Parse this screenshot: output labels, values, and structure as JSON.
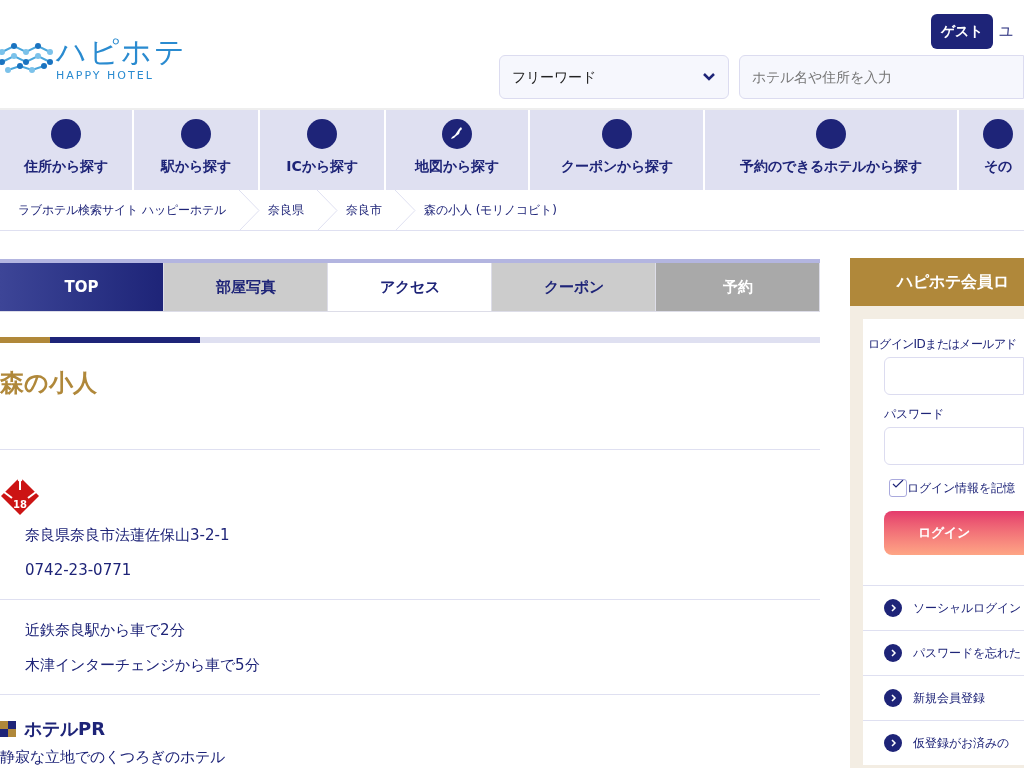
{
  "header": {
    "logo_text": "ハピホテ",
    "logo_sub": "HAPPY HOTEL",
    "guest_badge": "ゲスト",
    "user_link": "ユ",
    "search_select": "フリーワード",
    "search_placeholder": "ホテル名や住所を入力"
  },
  "nav": [
    {
      "label": "住所から探す",
      "kind": "blank"
    },
    {
      "label": "駅から探す",
      "kind": "blank"
    },
    {
      "label": "ICから探す",
      "kind": "blank"
    },
    {
      "label": "地図から探す",
      "kind": "map"
    },
    {
      "label": "クーポンから探す",
      "kind": "blank"
    },
    {
      "label": "予約のできるホテルから探す",
      "kind": "blank"
    },
    {
      "label": "その",
      "kind": "blank"
    }
  ],
  "breadcrumb": [
    "ラブホテル検索サイト ハッピーホテル",
    "奈良県",
    "奈良市",
    "森の小人 (モリノコビト)"
  ],
  "tabs": [
    {
      "label": "TOP",
      "kind": "home",
      "selected": false,
      "disabled": false
    },
    {
      "label": "部屋写真",
      "kind": "tab",
      "selected": false,
      "disabled": false
    },
    {
      "label": "アクセス",
      "kind": "tab",
      "selected": true,
      "disabled": false
    },
    {
      "label": "クーポン",
      "kind": "tab",
      "selected": false,
      "disabled": false
    },
    {
      "label": "予約",
      "kind": "tab",
      "selected": false,
      "disabled": true
    }
  ],
  "hotel_name": "森の小人",
  "age_badge": "18",
  "address": "奈良県奈良市法蓮佐保山3-2-1",
  "phone": "0742-23-0771",
  "access": [
    "近鉄奈良駅から車で2分",
    "木津インターチェンジから車で5分"
  ],
  "pr": {
    "heading": "ホテルPR",
    "text": "静寂な立地でのくつろぎのホテル"
  },
  "login": {
    "title": "ハピホテ会員ロ",
    "id_label": "ログインIDまたはメールアド",
    "password_label": "パスワード",
    "remember_label": "ログイン情報を記憶",
    "remember_checked": true,
    "button": "ログイン",
    "links": [
      "ソーシャルログイン",
      "パスワードを忘れた",
      "新規会員登録",
      "仮登録がお済みの"
    ]
  }
}
